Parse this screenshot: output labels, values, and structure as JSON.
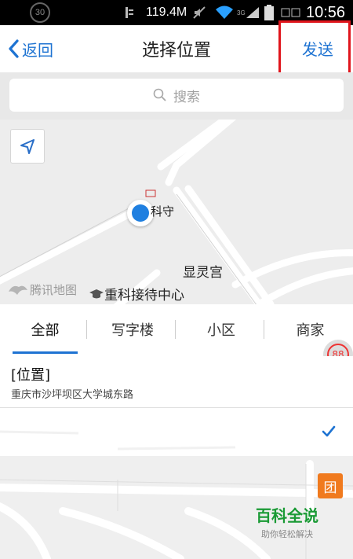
{
  "status_bar": {
    "badge_number": "30",
    "data_usage": "119.4M",
    "network_type": "3G",
    "time": "10:56"
  },
  "header": {
    "back_label": "返回",
    "title": "选择位置",
    "send_label": "发送"
  },
  "search": {
    "placeholder": "搜索"
  },
  "map": {
    "poi_partial": "科守",
    "poi_temple": "显灵宫",
    "poi_reception": "重科接待中心",
    "map_brand": "腾讯地图"
  },
  "tabs": [
    {
      "label": "全部",
      "active": true
    },
    {
      "label": "写字楼",
      "active": false
    },
    {
      "label": "小区",
      "active": false
    },
    {
      "label": "商家",
      "active": false
    }
  ],
  "badge_count": "88",
  "location_item": {
    "title": "[位置]",
    "address": "重庆市沙坪坝区大学城东路"
  },
  "tuan_icon_label": "团",
  "watermark": {
    "title": "百科全说",
    "subtitle": "助你轻松解决"
  },
  "colors": {
    "accent": "#1e73d2",
    "highlight_box": "#e0151c",
    "watermark": "#1a9a35"
  }
}
